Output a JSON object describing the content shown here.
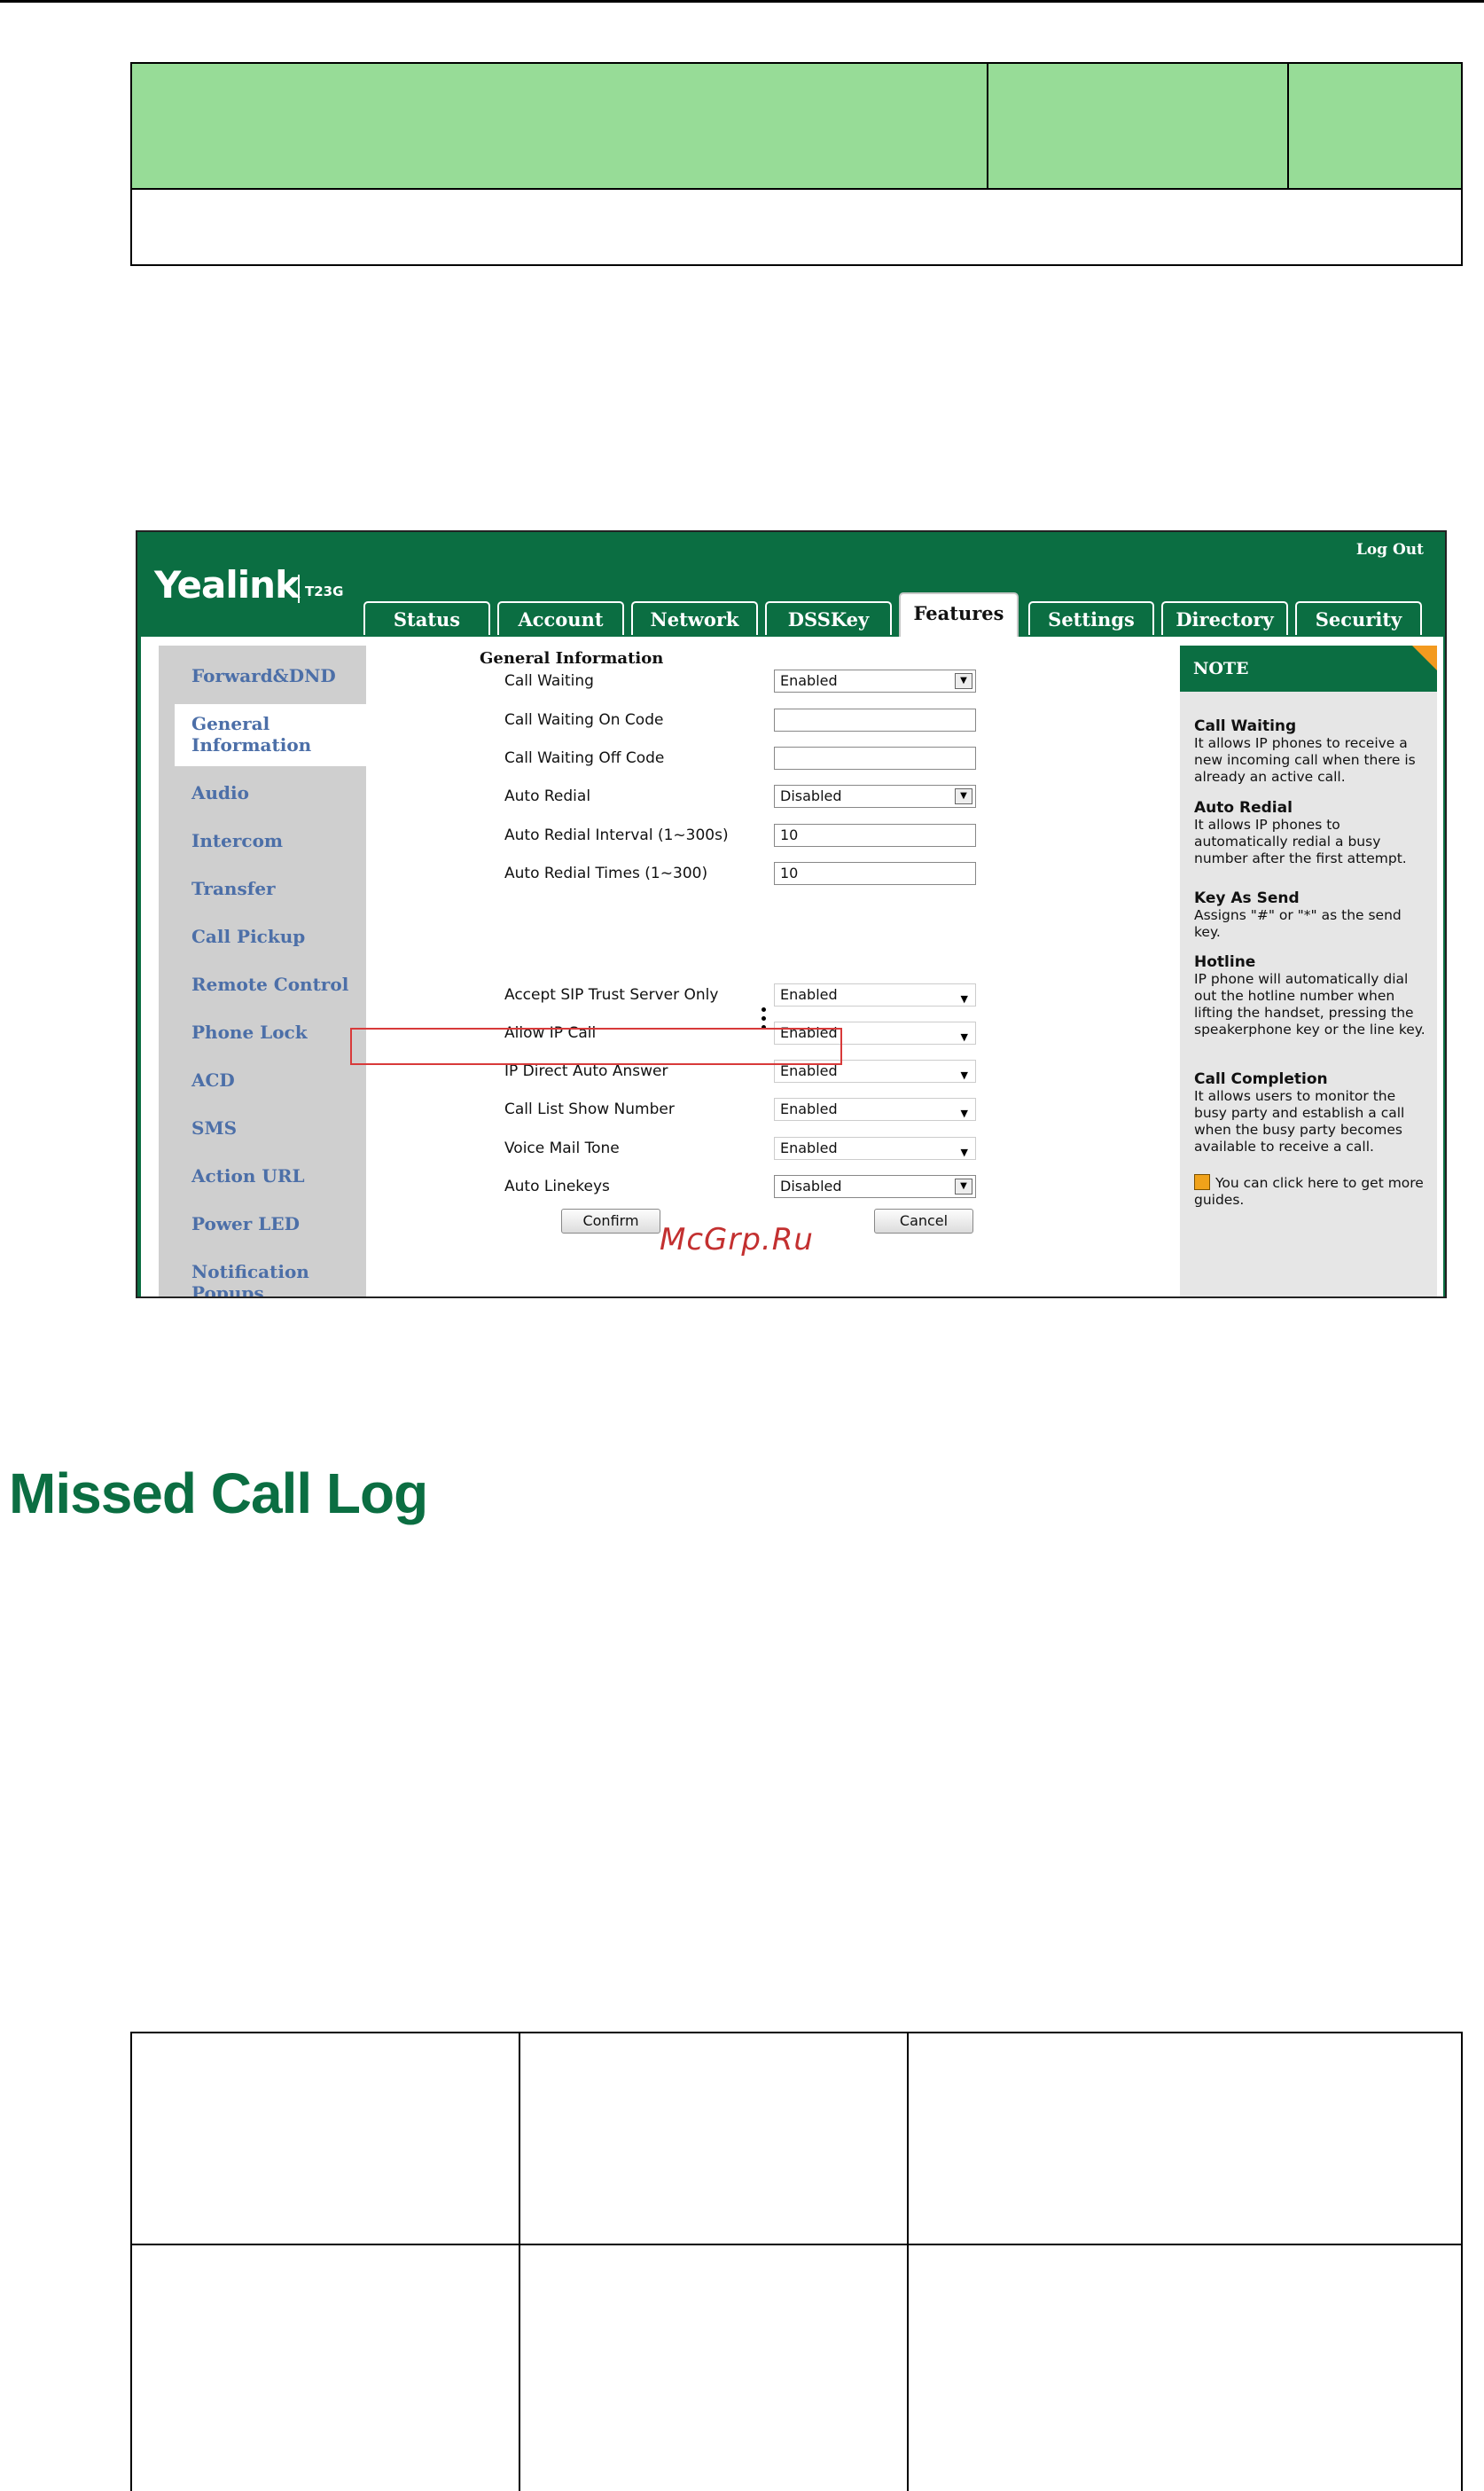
{
  "watermark": "McGrp.Ru",
  "section_heading": "Missed Call Log",
  "web_ui": {
    "logo": "Yealink",
    "model": "T23G",
    "logout": "Log Out",
    "tabs": [
      "Status",
      "Account",
      "Network",
      "DSSKey",
      "Features",
      "Settings",
      "Directory",
      "Security"
    ],
    "active_tab": "Features",
    "sidebar": [
      "Forward&DND",
      "General Information",
      "Audio",
      "Intercom",
      "Transfer",
      "Call Pickup",
      "Remote Control",
      "Phone Lock",
      "ACD",
      "SMS",
      "Action URL",
      "Power LED",
      "Notification Popups"
    ],
    "active_sidebar": "General Information",
    "section_title": "General Information",
    "fields": [
      {
        "label": "Call Waiting",
        "value": "Enabled",
        "type": "select"
      },
      {
        "label": "Call Waiting On Code",
        "value": "",
        "type": "text"
      },
      {
        "label": "Call Waiting Off Code",
        "value": "",
        "type": "text"
      },
      {
        "label": "Auto Redial",
        "value": "Disabled",
        "type": "select"
      },
      {
        "label": "Auto Redial Interval (1~300s)",
        "value": "10",
        "type": "text"
      },
      {
        "label": "Auto Redial Times (1~300)",
        "value": "10",
        "type": "text"
      },
      {
        "label": "Accept SIP Trust Server Only",
        "value": "Enabled",
        "type": "dropdown"
      },
      {
        "label": "Allow IP Call",
        "value": "Enabled",
        "type": "dropdown"
      },
      {
        "label": "IP Direct Auto Answer",
        "value": "Enabled",
        "type": "dropdown"
      },
      {
        "label": "Call List Show Number",
        "value": "Enabled",
        "type": "dropdown"
      },
      {
        "label": "Voice Mail Tone",
        "value": "Enabled",
        "type": "dropdown"
      },
      {
        "label": "Auto Linekeys",
        "value": "Disabled",
        "type": "select"
      }
    ],
    "confirm": "Confirm",
    "cancel": "Cancel",
    "note": {
      "title": "NOTE",
      "items": [
        {
          "title": "Call Waiting",
          "text": "It allows IP phones to receive a new incoming call when there is already an active call."
        },
        {
          "title": "Auto Redial",
          "text": "It allows IP phones to automatically redial a busy number after the first attempt."
        },
        {
          "title": "Key As Send",
          "text": "Assigns \"#\" or \"*\" as the send key."
        },
        {
          "title": "Hotline",
          "text": "IP phone will automatically dial out the hotline number when lifting the handset, pressing the speakerphone key or the line key."
        },
        {
          "title": "Call Completion",
          "text": "It allows users to monitor the busy party and establish a call when the busy party becomes available to receive a call."
        }
      ],
      "guide": "You can click here to get more guides."
    }
  }
}
